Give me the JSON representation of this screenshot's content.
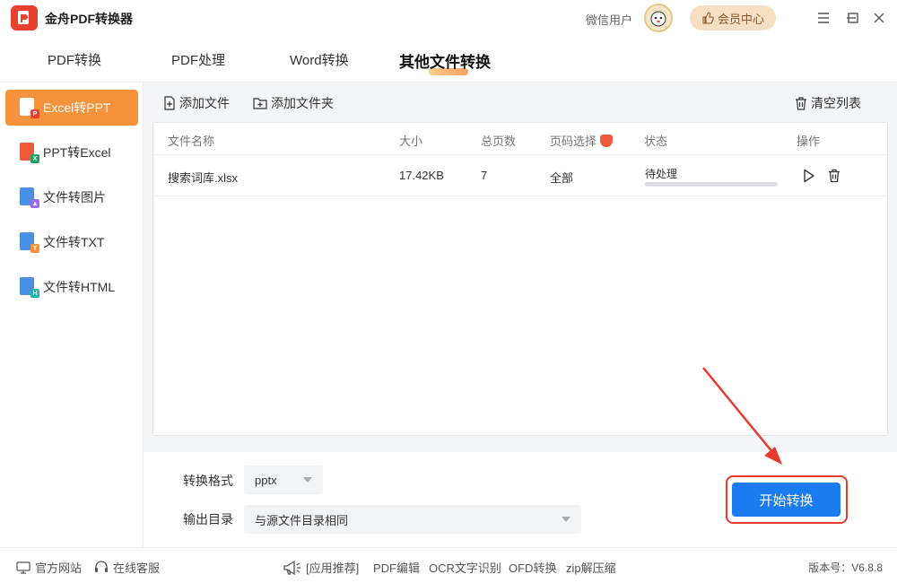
{
  "app": {
    "title": "金舟PDF转换器",
    "user_name": "微信用户",
    "member_label": "会员中心"
  },
  "top_tabs": [
    {
      "label": "PDF转换",
      "active": false
    },
    {
      "label": "PDF处理",
      "active": false
    },
    {
      "label": "Word转换",
      "active": false
    },
    {
      "label": "其他文件转换",
      "active": true
    }
  ],
  "sidebar": {
    "items": [
      {
        "label": "Excel转PPT",
        "active": true,
        "icon": "excel-to-ppt-icon"
      },
      {
        "label": "PPT转Excel",
        "active": false,
        "icon": "ppt-to-excel-icon"
      },
      {
        "label": "文件转图片",
        "active": false,
        "icon": "file-to-image-icon"
      },
      {
        "label": "文件转TXT",
        "active": false,
        "icon": "file-to-txt-icon"
      },
      {
        "label": "文件转HTML",
        "active": false,
        "icon": "file-to-html-icon"
      }
    ]
  },
  "toolbar": {
    "add_file": "添加文件",
    "add_folder": "添加文件夹",
    "clear_list": "清空列表"
  },
  "table": {
    "headers": {
      "name": "文件名称",
      "size": "大小",
      "pages": "总页数",
      "page_select": "页码选择",
      "status": "状态",
      "actions": "操作"
    },
    "rows": [
      {
        "name": "搜索词库.xlsx",
        "size": "17.42KB",
        "pages": "7",
        "page_select": "全部",
        "status": "待处理",
        "progress": 0
      }
    ]
  },
  "settings": {
    "format_label": "转换格式",
    "format_value": "pptx",
    "output_label": "输出目录",
    "output_value": "与源文件目录相同",
    "start_button": "开始转换"
  },
  "footer": {
    "official_site": "官方网站",
    "online_service": "在线客服",
    "recommend": "[应用推荐]",
    "links": [
      "PDF编辑",
      "OCR文字识别",
      "OFD转换",
      "zip解压缩"
    ],
    "version": "版本号：V6.8.8"
  },
  "colors": {
    "accent": "#f5923b",
    "primary": "#1a7cf0",
    "highlight": "#e83a2f"
  }
}
